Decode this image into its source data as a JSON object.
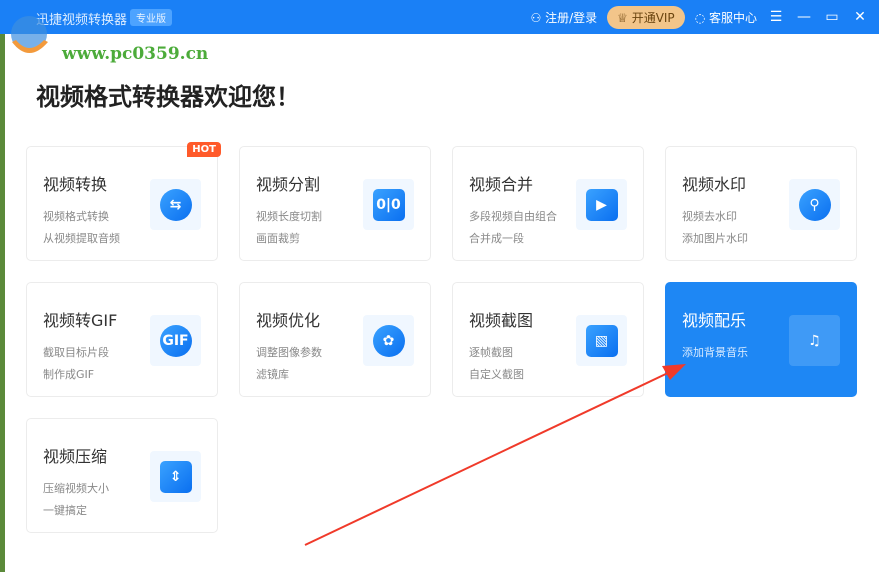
{
  "titlebar": {
    "app_title": "迅捷视频转换器",
    "badge": "专业版",
    "login": "注册/登录",
    "vip": "开通VIP",
    "service": "客服中心"
  },
  "watermark": {
    "site": "www.pc0359.cn"
  },
  "heading": "视频格式转换器欢迎您！",
  "hot_label": "HOT",
  "cards": [
    {
      "title": "视频转换",
      "desc1": "视频格式转换",
      "desc2": "从视频提取音频",
      "icon": "⇆"
    },
    {
      "title": "视频分割",
      "desc1": "视频长度切割",
      "desc2": "画面裁剪",
      "icon": "0|0"
    },
    {
      "title": "视频合并",
      "desc1": "多段视频自由组合",
      "desc2": "合并成一段",
      "icon": "▶"
    },
    {
      "title": "视频水印",
      "desc1": "视频去水印",
      "desc2": "添加图片水印",
      "icon": "⚲"
    },
    {
      "title": "视频转GIF",
      "desc1": "截取目标片段",
      "desc2": "制作成GIF",
      "icon": "GIF"
    },
    {
      "title": "视频优化",
      "desc1": "调整图像参数",
      "desc2": "滤镜库",
      "icon": "✿"
    },
    {
      "title": "视频截图",
      "desc1": "逐帧截图",
      "desc2": "自定义截图",
      "icon": "▧"
    },
    {
      "title": "视频配乐",
      "desc1": "添加背景音乐",
      "desc2": "",
      "icon": "♫"
    },
    {
      "title": "视频压缩",
      "desc1": "压缩视频大小",
      "desc2": "一键搞定",
      "icon": "⇕"
    }
  ]
}
